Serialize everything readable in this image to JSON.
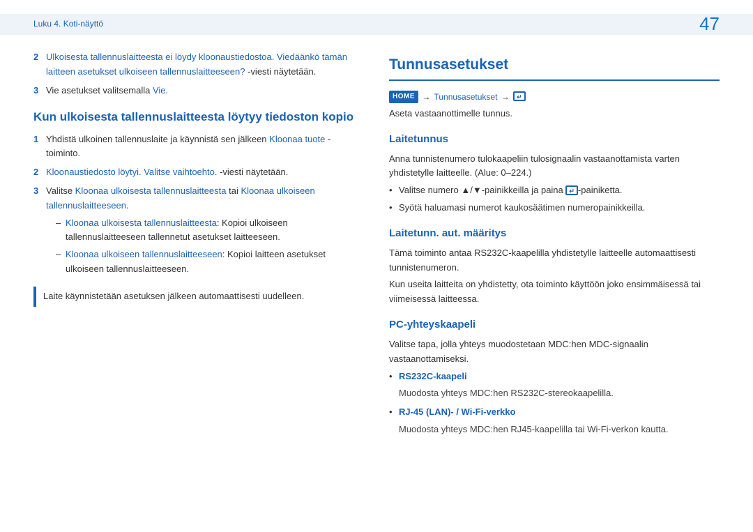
{
  "chapter": "Luku 4. Koti-näyttö",
  "page_number": "47",
  "left": {
    "list1": {
      "n2a": "Ulkoisesta tallennuslaitteesta ei löydy kloonaustiedostoa. Viedäänkö tämän laitteen asetukset ulkoiseen tallennuslaitteeseen?",
      "n2b": " -viesti näytetään.",
      "n3a": "Vie asetukset valitsemalla ",
      "n3b": "Vie",
      "n3c": "."
    },
    "h2": "Kun ulkoisesta tallennuslaitteesta löytyy tiedoston kopio",
    "list2": {
      "n1a": "Yhdistä ulkoinen tallennuslaite ja käynnistä sen jälkeen ",
      "n1b": "Kloonaa tuote",
      "n1c": " -toiminto.",
      "n2a": "Kloonaustiedosto löytyi. Valitse vaihtoehto.",
      "n2b": " -viesti näytetään.",
      "n3a": "Valitse ",
      "n3b": "Kloonaa ulkoisesta tallennuslaitteesta",
      "n3c": " tai ",
      "n3d": "Kloonaa ulkoiseen tallennuslaitteeseen",
      "n3e": ".",
      "s1a": "Kloonaa ulkoisesta tallennuslaitteesta",
      "s1b": ": Kopioi ulkoiseen tallennuslaitteeseen tallennetut asetukset laitteeseen.",
      "s2a": "Kloonaa ulkoiseen tallennuslaitteeseen",
      "s2b": ": Kopioi laitteen asetukset ulkoiseen tallennuslaitteeseen."
    },
    "note": "Laite käynnistetään asetuksen jälkeen automaattisesti uudelleen."
  },
  "right": {
    "h1": "Tunnusasetukset",
    "nav_home": "HOME",
    "nav_label": "Tunnusasetukset",
    "intro": "Aseta vastaanottimelle tunnus.",
    "sec1": {
      "title": "Laitetunnus",
      "p1": "Anna tunnistenumero tulokaapeliin tulosignaalin vastaanottamista varten yhdistetylle laitteelle. (Alue: 0–224.)",
      "b1a": "Valitse numero ▲/▼-painikkeilla ja paina ",
      "b1b": "-painiketta.",
      "b2": "Syötä haluamasi numerot kaukosäätimen numeropainikkeilla."
    },
    "sec2": {
      "title": "Laitetunn. aut. määritys",
      "p1": "Tämä toiminto antaa RS232C-kaapelilla yhdistetylle laitteelle automaattisesti tunnistenumeron.",
      "p2": "Kun useita laitteita on yhdistetty, ota toiminto käyttöön joko ensimmäisessä tai viimeisessä laitteessa."
    },
    "sec3": {
      "title": "PC-yhteyskaapeli",
      "p1": "Valitse tapa, jolla yhteys muodostetaan MDC:hen MDC-signaalin vastaanottamiseksi.",
      "b1t": "RS232C-kaapeli",
      "b1d": "Muodosta yhteys MDC:hen RS232C-stereokaapelilla.",
      "b2t": "RJ-45 (LAN)- / Wi-Fi-verkko",
      "b2d": "Muodosta yhteys MDC:hen RJ45-kaapelilla tai Wi-Fi-verkon kautta."
    }
  }
}
